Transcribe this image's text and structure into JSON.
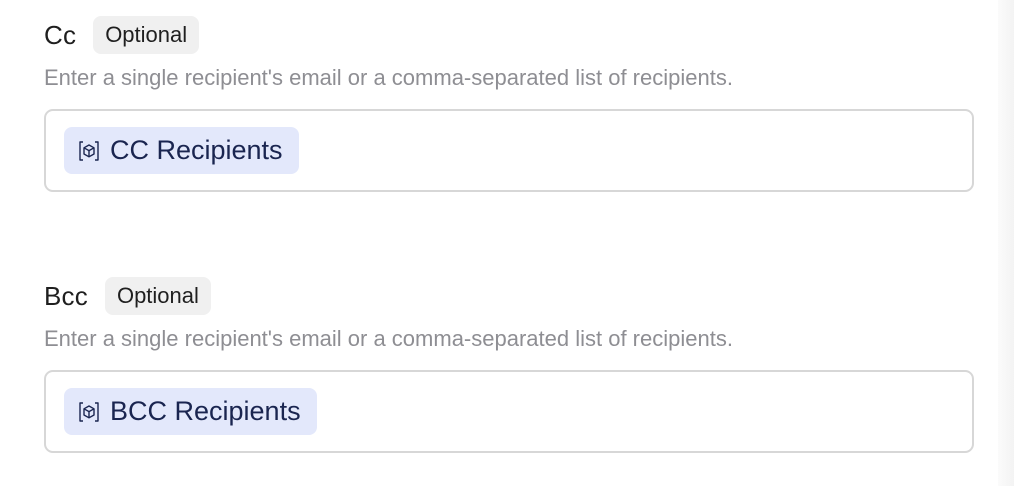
{
  "cc": {
    "label": "Cc",
    "badge": "Optional",
    "help": "Enter a single recipient's email or a comma-separated list of recipients.",
    "chip_label": "CC Recipients",
    "chip_icon": "variable-cube-icon"
  },
  "bcc": {
    "label": "Bcc",
    "badge": "Optional",
    "help": "Enter a single recipient's email or a comma-separated list of recipients.",
    "chip_label": "BCC Recipients",
    "chip_icon": "variable-cube-icon"
  },
  "colors": {
    "chip_bg": "#e3e8fb",
    "chip_text": "#1a2550",
    "help_text": "#8e8e93",
    "badge_bg": "#f0f0f0",
    "border": "#d7d7d7"
  }
}
